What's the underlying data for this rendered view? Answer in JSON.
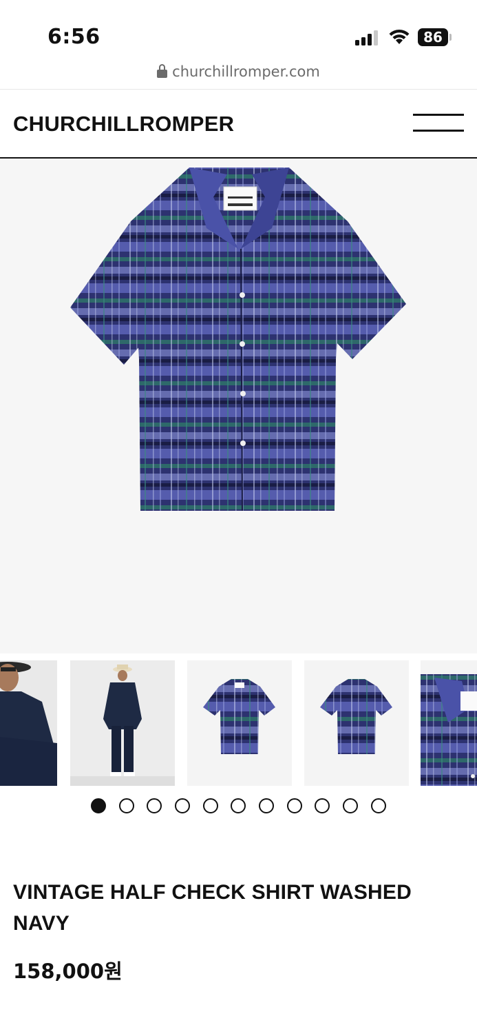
{
  "status_bar": {
    "time": "6:56",
    "battery": "86",
    "icons": [
      "signal-icon",
      "wifi-icon",
      "battery-icon"
    ]
  },
  "browser": {
    "url": "churchillromper.com",
    "lock_icon": "lock-icon"
  },
  "header": {
    "logo": "CHURCHILLROMPER",
    "menu_icon": "hamburger-menu-icon"
  },
  "gallery": {
    "main_image": "Vintage half check shirt washed navy, front view",
    "thumbnails": [
      "Model seated wearing navy jacket and hat",
      "Model standing full-length in navy outfit with straw hat",
      "Shirt front view",
      "Shirt back view",
      "Shirt collar close-up"
    ],
    "dot_count": 11,
    "active_index": 0
  },
  "product": {
    "name": "VINTAGE HALF CHECK SHIRT WASHED NAVY",
    "price": "158,000원"
  },
  "colors": {
    "navy": "#2a2f6a",
    "check_blue": "#6a72c8",
    "check_green": "#2f6f6a",
    "text": "#111111",
    "hero_bg": "#f6f6f6"
  }
}
